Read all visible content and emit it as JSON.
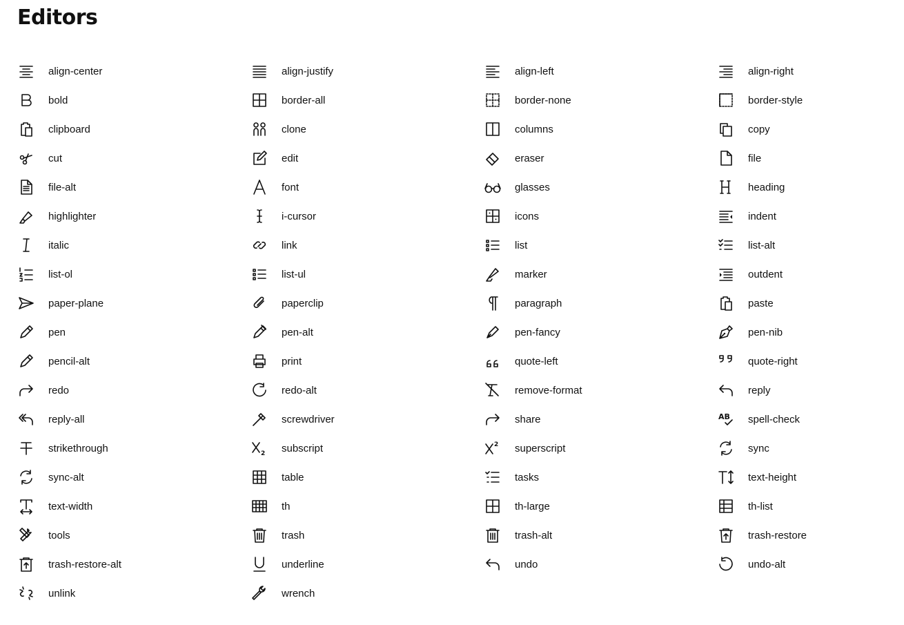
{
  "page_title": "Editors",
  "icons": [
    {
      "name": "align-center"
    },
    {
      "name": "align-justify"
    },
    {
      "name": "align-left"
    },
    {
      "name": "align-right"
    },
    {
      "name": "bold"
    },
    {
      "name": "border-all"
    },
    {
      "name": "border-none"
    },
    {
      "name": "border-style"
    },
    {
      "name": "clipboard"
    },
    {
      "name": "clone"
    },
    {
      "name": "columns"
    },
    {
      "name": "copy"
    },
    {
      "name": "cut"
    },
    {
      "name": "edit"
    },
    {
      "name": "eraser"
    },
    {
      "name": "file"
    },
    {
      "name": "file-alt"
    },
    {
      "name": "font"
    },
    {
      "name": "glasses"
    },
    {
      "name": "heading"
    },
    {
      "name": "highlighter"
    },
    {
      "name": "i-cursor"
    },
    {
      "name": "icons"
    },
    {
      "name": "indent"
    },
    {
      "name": "italic"
    },
    {
      "name": "link"
    },
    {
      "name": "list"
    },
    {
      "name": "list-alt"
    },
    {
      "name": "list-ol"
    },
    {
      "name": "list-ul"
    },
    {
      "name": "marker"
    },
    {
      "name": "outdent"
    },
    {
      "name": "paper-plane"
    },
    {
      "name": "paperclip"
    },
    {
      "name": "paragraph"
    },
    {
      "name": "paste"
    },
    {
      "name": "pen"
    },
    {
      "name": "pen-alt"
    },
    {
      "name": "pen-fancy"
    },
    {
      "name": "pen-nib"
    },
    {
      "name": "pencil-alt"
    },
    {
      "name": "print"
    },
    {
      "name": "quote-left"
    },
    {
      "name": "quote-right"
    },
    {
      "name": "redo"
    },
    {
      "name": "redo-alt"
    },
    {
      "name": "remove-format"
    },
    {
      "name": "reply"
    },
    {
      "name": "reply-all"
    },
    {
      "name": "screwdriver"
    },
    {
      "name": "share"
    },
    {
      "name": "spell-check"
    },
    {
      "name": "strikethrough"
    },
    {
      "name": "subscript"
    },
    {
      "name": "superscript"
    },
    {
      "name": "sync"
    },
    {
      "name": "sync-alt"
    },
    {
      "name": "table"
    },
    {
      "name": "tasks"
    },
    {
      "name": "text-height"
    },
    {
      "name": "text-width"
    },
    {
      "name": "th"
    },
    {
      "name": "th-large"
    },
    {
      "name": "th-list"
    },
    {
      "name": "tools"
    },
    {
      "name": "trash"
    },
    {
      "name": "trash-alt"
    },
    {
      "name": "trash-restore"
    },
    {
      "name": "trash-restore-alt"
    },
    {
      "name": "underline"
    },
    {
      "name": "undo"
    },
    {
      "name": "undo-alt"
    },
    {
      "name": "unlink"
    },
    {
      "name": "wrench"
    }
  ]
}
